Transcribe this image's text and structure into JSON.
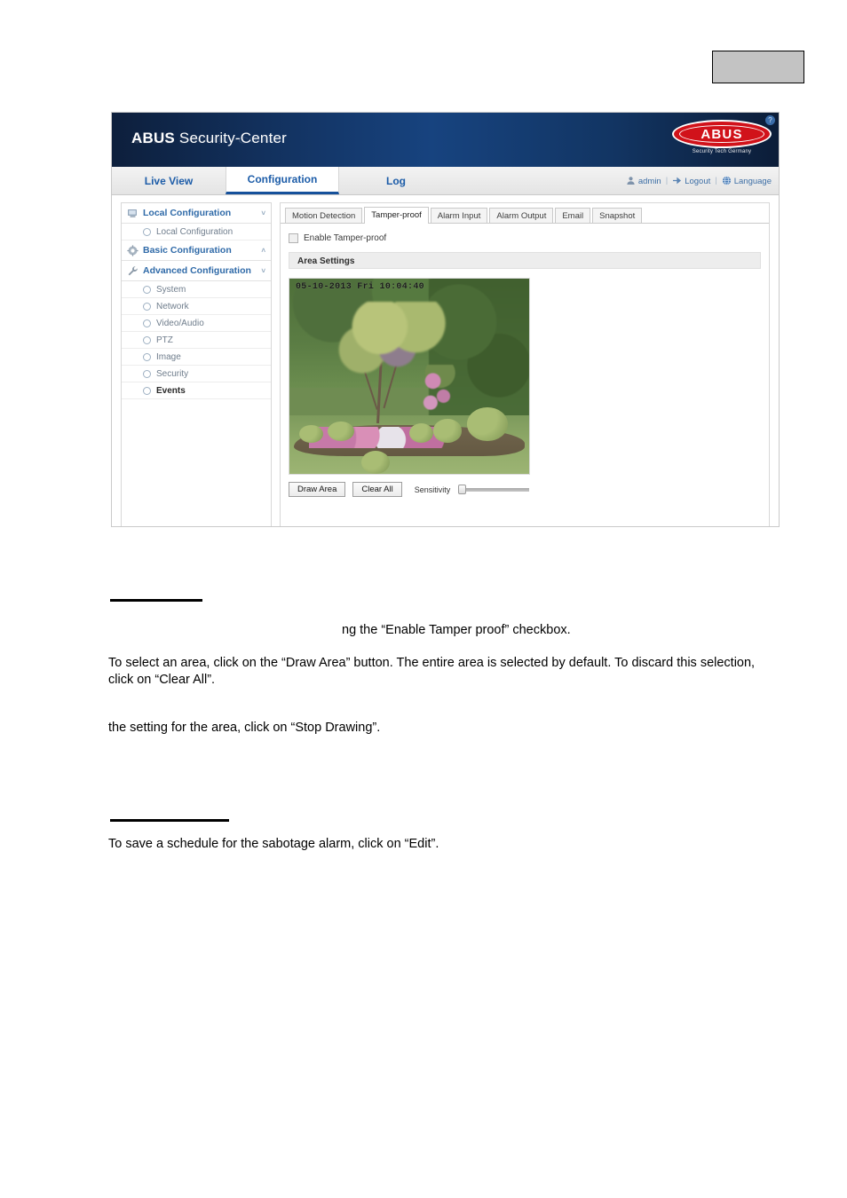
{
  "gray_box": {
    "label": ""
  },
  "app": {
    "banner": {
      "title_bold": "ABUS",
      "title_light": " Security-Center",
      "logo_word": "ABUS",
      "logo_tagline": "Security Tech Germany",
      "help_glyph": "?"
    },
    "nav": {
      "tabs": [
        {
          "label": "Live View",
          "active": false
        },
        {
          "label": "Configuration",
          "active": true
        },
        {
          "label": "Log",
          "active": false
        }
      ],
      "user": "admin",
      "logout": "Logout",
      "language": "Language",
      "separator": "|"
    },
    "sidebar": {
      "groups": [
        {
          "label": "Local Configuration",
          "icon": "monitor-icon",
          "caret": "˅"
        },
        {
          "label": "Basic Configuration",
          "icon": "gear-icon",
          "caret": "˄"
        },
        {
          "label": "Advanced Configuration",
          "icon": "wrench-icon",
          "caret": "˅"
        }
      ],
      "local_items": [
        "Local Configuration"
      ],
      "advanced_items": [
        {
          "label": "System",
          "selected": false
        },
        {
          "label": "Network",
          "selected": false
        },
        {
          "label": "Video/Audio",
          "selected": false
        },
        {
          "label": "PTZ",
          "selected": false
        },
        {
          "label": "Image",
          "selected": false
        },
        {
          "label": "Security",
          "selected": false
        },
        {
          "label": "Events",
          "selected": true
        }
      ]
    },
    "content": {
      "tabs": [
        {
          "label": "Motion Detection",
          "active": false
        },
        {
          "label": "Tamper-proof",
          "active": true
        },
        {
          "label": "Alarm Input",
          "active": false
        },
        {
          "label": "Alarm Output",
          "active": false
        },
        {
          "label": "Email",
          "active": false
        },
        {
          "label": "Snapshot",
          "active": false
        }
      ],
      "enable_checkbox_label": "Enable Tamper-proof",
      "enable_checkbox_checked": false,
      "section_title": "Area Settings",
      "video_timestamp": "05-10-2013 Fri 10:04:40",
      "draw_area_button": "Draw Area",
      "clear_all_button": "Clear All",
      "sensitivity_label": "Sensitivity",
      "sensitivity_value": 0
    }
  },
  "document": {
    "paragraph_1": "ng the “Enable Tamper proof” checkbox.",
    "paragraph_2": "To select an area, click on the “Draw Area” button. The entire area is selected by default. To discard this selection, click on “Clear All”.",
    "paragraph_3": "the setting for the area, click on “Stop Drawing”.",
    "paragraph_4": "To save a schedule for the sabotage alarm, click on “Edit”."
  }
}
